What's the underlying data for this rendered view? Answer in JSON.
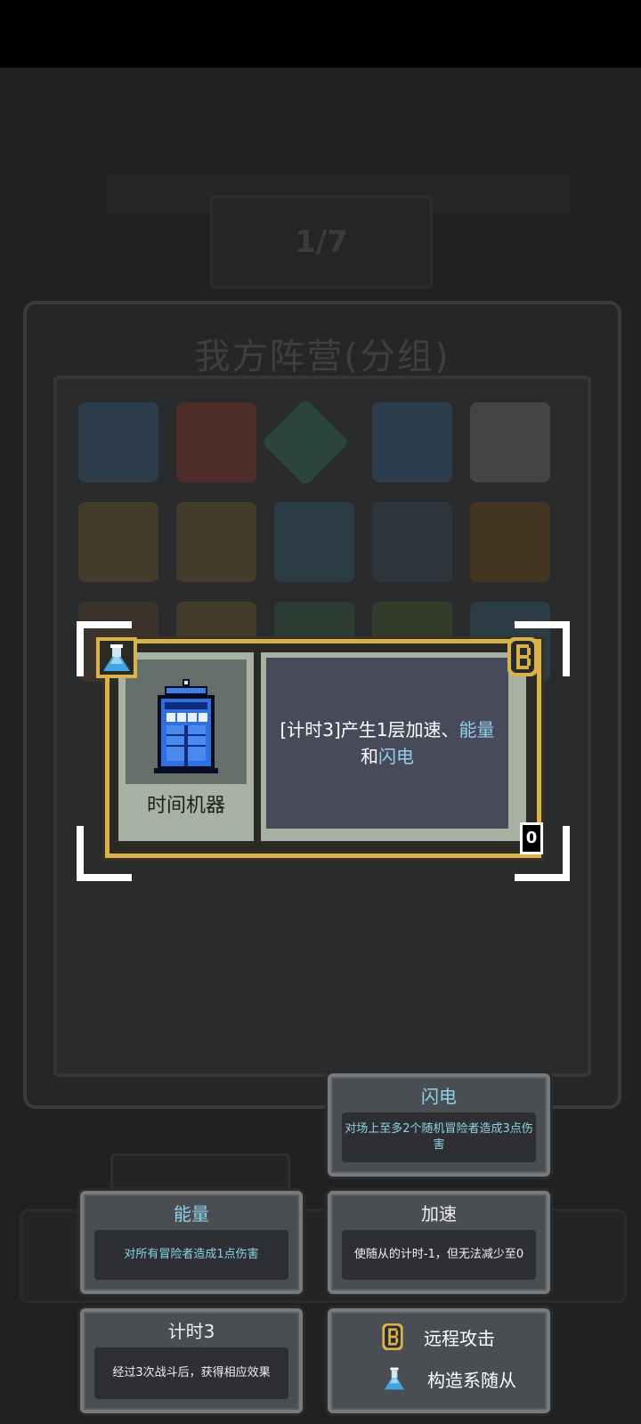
{
  "background": {
    "top_button_label": "1/7",
    "panel_title": "我方阵营(分组)"
  },
  "card": {
    "name": "时间机器",
    "desc_prefix": "[计时3]产生1层加速、",
    "desc_energy": "能量",
    "desc_and": "和",
    "desc_lightning": "闪电",
    "count": "0",
    "portrait_icon": "blue-police-box-icon",
    "type_icon": "flask-icon",
    "attack_icon": "ranged-attack-icon"
  },
  "tooltips": {
    "lightning": {
      "title": "闪电",
      "body": "对场上至多2个随机冒险者造成3点伤害"
    },
    "energy": {
      "title": "能量",
      "body": "对所有冒险者造成1点伤害"
    },
    "speedup": {
      "title": "加速",
      "body": "使随从的计时-1，但无法减少至0"
    },
    "timer": {
      "title": "计时3",
      "body": "经过3次战斗后，获得相应效果"
    }
  },
  "traits": [
    {
      "label": "远程攻击",
      "icon": "ranged-attack-icon"
    },
    {
      "label": "构造系随从",
      "icon": "flask-icon"
    }
  ],
  "colors": {
    "card_border": "#d8b24a",
    "keyword": "#8ed2ea",
    "desc_bg": "#484a5a"
  }
}
